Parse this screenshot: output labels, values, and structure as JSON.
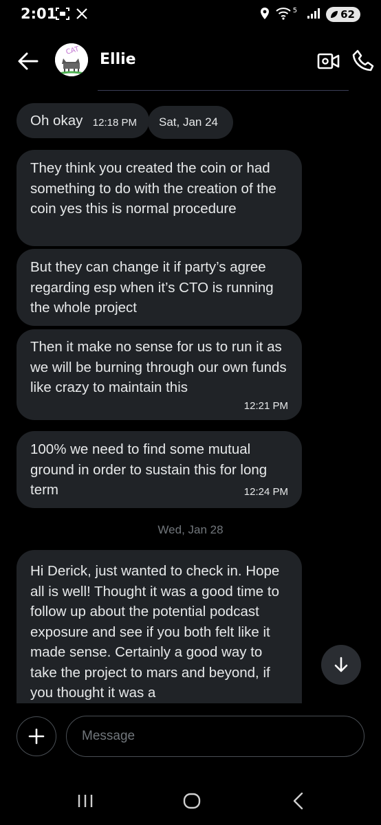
{
  "status": {
    "time": "2:01",
    "network": "5",
    "battery": "62"
  },
  "header": {
    "contact_name": "Ellie",
    "avatar_text": "CAT"
  },
  "messages": [
    {
      "text": "Oh okay",
      "time": "12:18 PM"
    },
    {
      "text": "They think you created the coin or had something to do with the creation of the coin yes this is normal procedure"
    },
    {
      "text": "But they can change it if party’s agree regarding esp when it’s CTO is running the whole project"
    },
    {
      "text": "Then it make no sense for us to run it as we will be burning through our own funds like crazy to maintain this",
      "time": "12:21 PM"
    },
    {
      "text": "100% we need to find some mutual ground in order to sustain this for long term",
      "time": "12:24 PM"
    },
    {
      "text": "Hi Derick, just wanted to check in. Hope all is well! Thought it was a good time to follow up about the potential podcast exposure and see if you both felt like it made sense. Certainly a good way to take the project to mars and beyond, if you thought it was a"
    }
  ],
  "dates": {
    "sat": "Sat, Jan 24",
    "wed": "Wed, Jan 28"
  },
  "composer": {
    "placeholder": "Message"
  },
  "colors": {
    "background": "#000000",
    "bubble": "#202327",
    "text": "#e7e9ea",
    "muted": "#71767b"
  }
}
